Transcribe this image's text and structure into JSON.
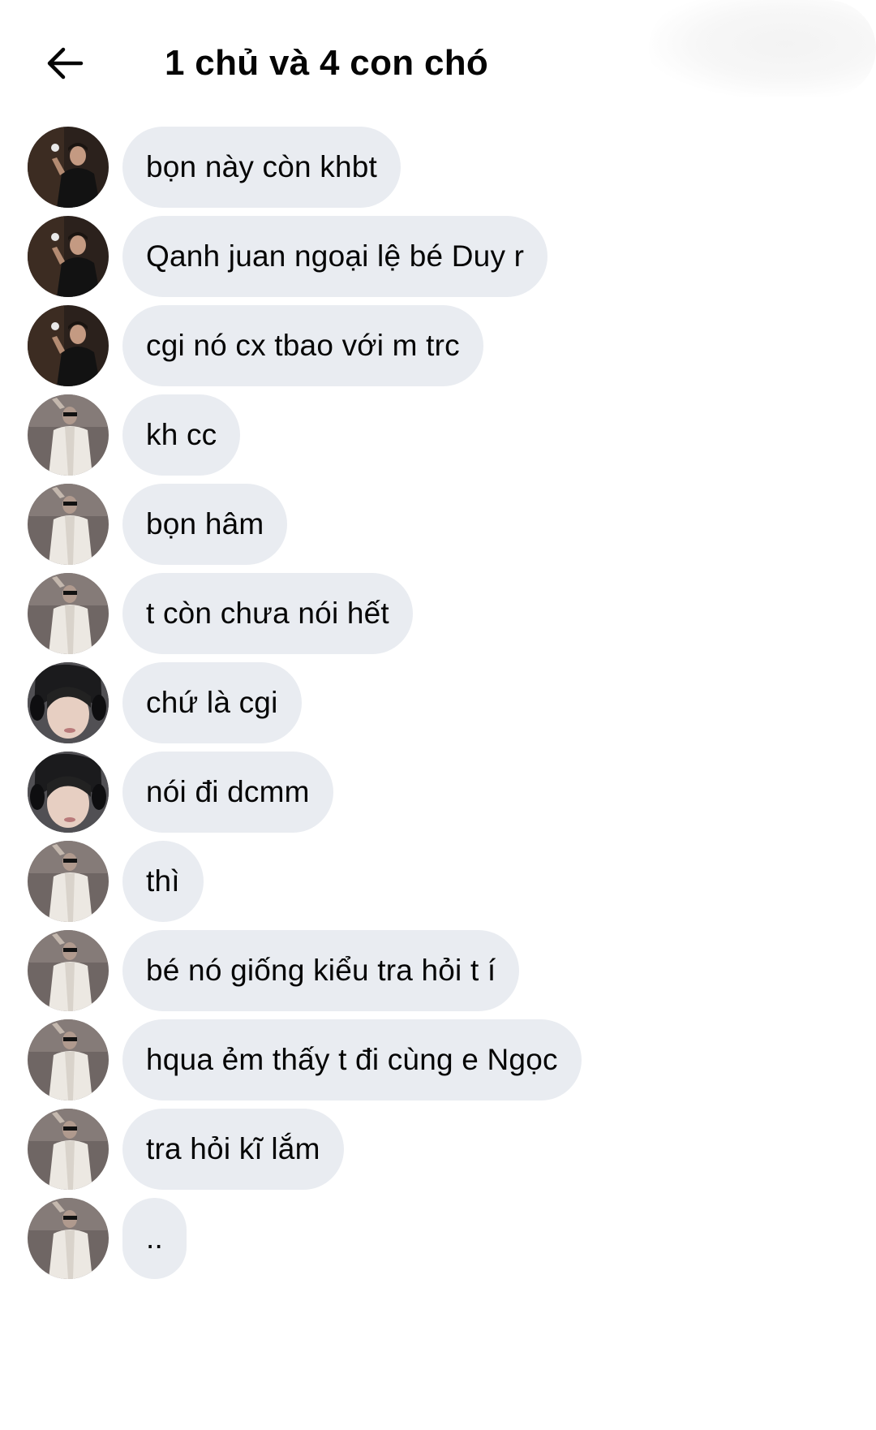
{
  "header": {
    "back_icon": "arrow-left-icon",
    "title": "1 chủ và 4 con chó"
  },
  "messages": [
    {
      "sender": "a",
      "text": "bọn này còn khbt"
    },
    {
      "sender": "a",
      "text": "Qanh juan ngoại lệ bé Duy r"
    },
    {
      "sender": "a",
      "text": "cgi nó cx tbao với m trc"
    },
    {
      "sender": "b",
      "text": "kh cc"
    },
    {
      "sender": "b",
      "text": "bọn hâm"
    },
    {
      "sender": "b",
      "text": "t còn chưa nói hết"
    },
    {
      "sender": "c",
      "text": "chứ là cgi"
    },
    {
      "sender": "c",
      "text": "nói đi dcmm"
    },
    {
      "sender": "b",
      "text": "thì"
    },
    {
      "sender": "b",
      "text": "bé nó giống kiểu tra hỏi t í"
    },
    {
      "sender": "b",
      "text": "hqua ẻm thấy t đi cùng e Ngọc"
    },
    {
      "sender": "b",
      "text": "tra hỏi kĩ lắm"
    },
    {
      "sender": "b",
      "text": ".."
    }
  ],
  "colors": {
    "bubble_bg": "#e9ecf1",
    "text": "#050505",
    "background": "#ffffff"
  }
}
